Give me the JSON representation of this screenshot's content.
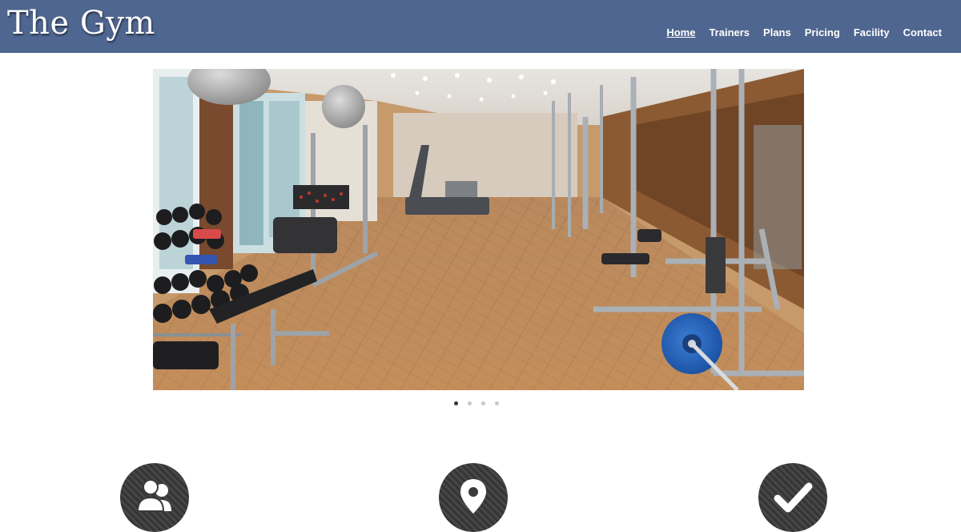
{
  "header": {
    "logo": "The Gym",
    "nav": [
      {
        "label": "Home",
        "active": true
      },
      {
        "label": "Trainers",
        "active": false
      },
      {
        "label": "Plans",
        "active": false
      },
      {
        "label": "Pricing",
        "active": false
      },
      {
        "label": "Facility",
        "active": false
      },
      {
        "label": "Contact",
        "active": false
      }
    ]
  },
  "hero": {
    "image_subject": "gym interior with dumbbells, exercise machines and treadmills",
    "slide_count": 4,
    "active_slide": 1
  },
  "features": [
    {
      "icon": "users-icon"
    },
    {
      "icon": "location-pin-icon"
    },
    {
      "icon": "checkmark-icon"
    }
  ],
  "colors": {
    "header_bg": "#4f6690",
    "feature_circle": "#3a3a3a"
  }
}
